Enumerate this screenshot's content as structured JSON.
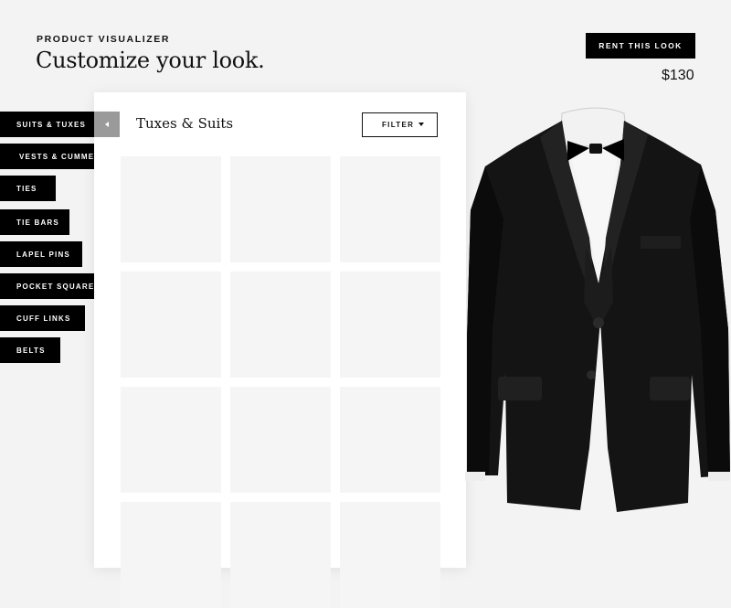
{
  "header": {
    "eyebrow": "PRODUCT VISUALIZER",
    "title": "Customize your look.",
    "rent_label": "RENT THIS LOOK",
    "price": "$130"
  },
  "categories": [
    {
      "label": "SUITS & TUXES",
      "active": true
    },
    {
      "label": "VESTS & CUMMERBUNDS",
      "active": false
    },
    {
      "label": "TIES",
      "active": false
    },
    {
      "label": "TIE BARS",
      "active": false
    },
    {
      "label": "LAPEL PINS",
      "active": false
    },
    {
      "label": "POCKET SQUARES",
      "active": false
    },
    {
      "label": "CUFF LINKS",
      "active": false
    },
    {
      "label": "BELTS",
      "active": false
    }
  ],
  "panel": {
    "title": "Tuxes & Suits",
    "filter_label": "FILTER"
  },
  "icons": {
    "collapse": "chevron-left-icon",
    "filter_caret": "caret-down-icon"
  },
  "colors": {
    "accent": "#000000",
    "background": "#f3f3f3",
    "tile": "#f5f5f5",
    "collapse_tab": "#9a9a9a"
  }
}
